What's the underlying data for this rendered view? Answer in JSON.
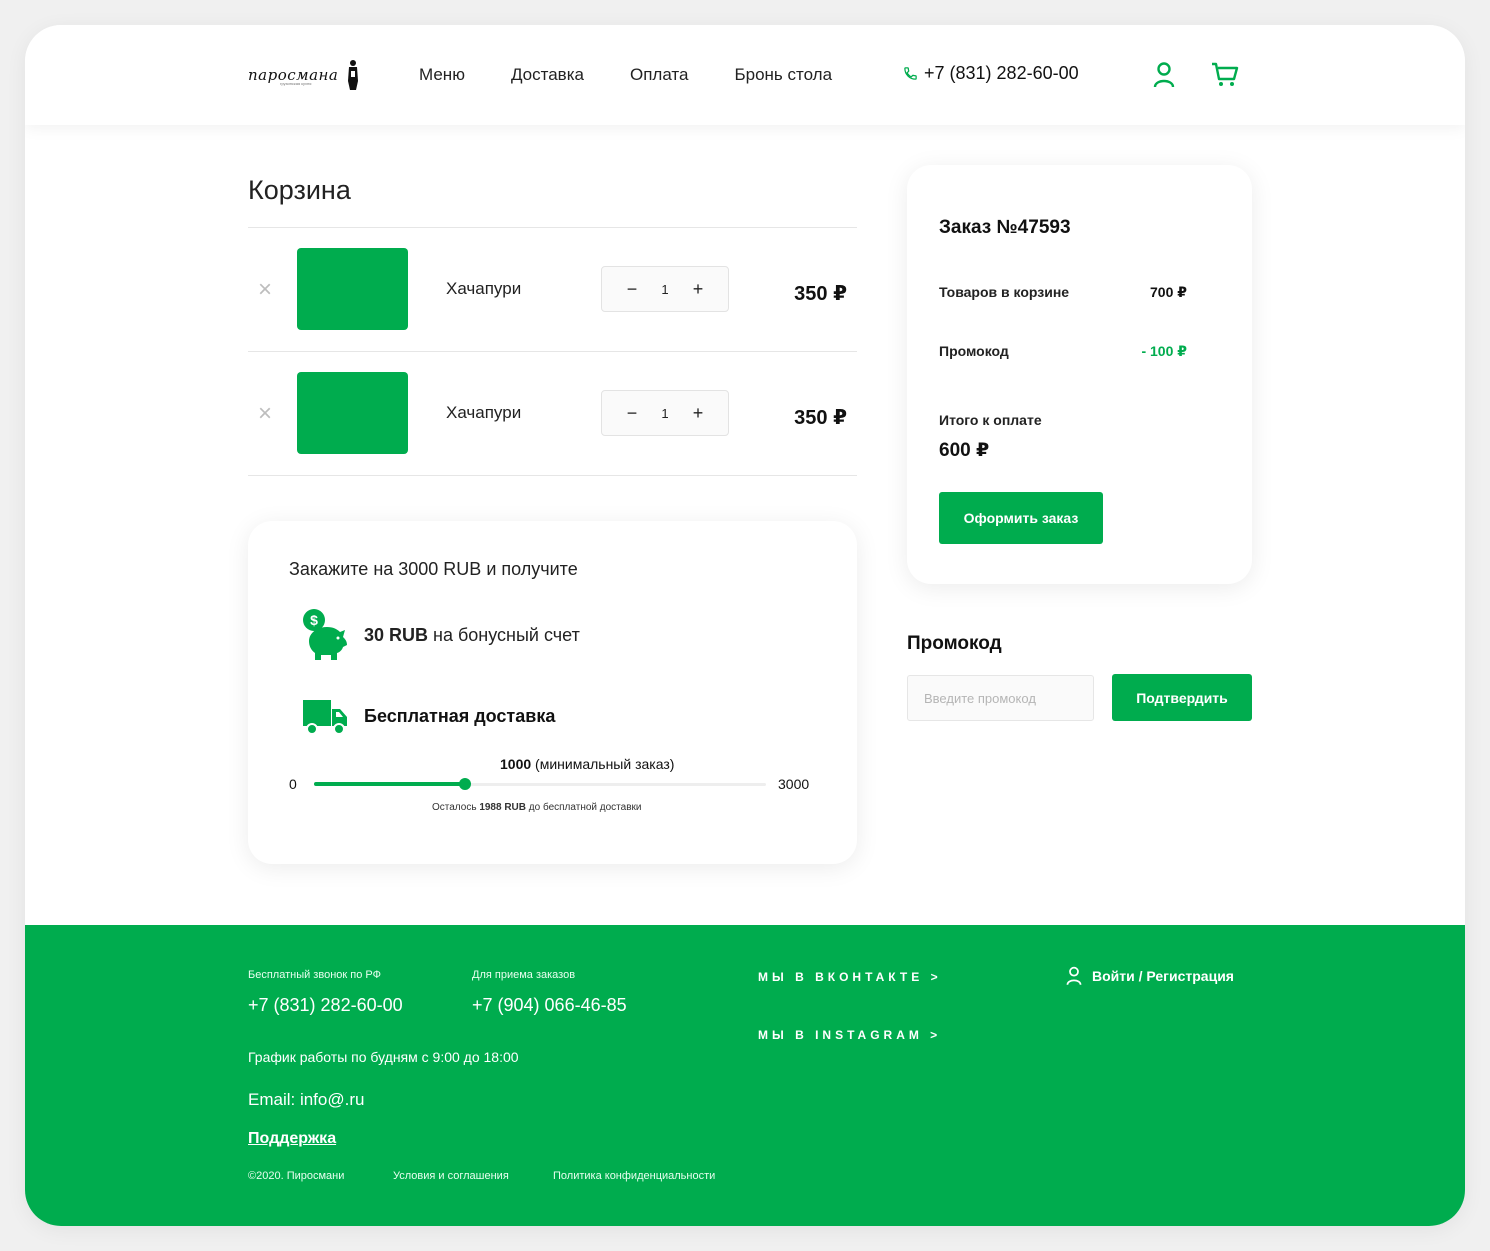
{
  "colors": {
    "accent": "#00ac4e",
    "text": "#1a1a1a",
    "muted": "#bdbdbd"
  },
  "header": {
    "logo_text": "паросмана",
    "logo_sub": "грузинская кухня",
    "nav": [
      "Меню",
      "Доставка",
      "Оплата",
      "Бронь стола"
    ],
    "phone": "+7 (831) 282-60-00",
    "icons": [
      "phone-icon",
      "user-icon",
      "cart-icon"
    ]
  },
  "cart": {
    "title": "Корзина",
    "items": [
      {
        "name": "Хачапури",
        "qty": "1",
        "price": "350 ₽",
        "minus": "−",
        "plus": "+",
        "remove": "×"
      },
      {
        "name": "Хачапури",
        "qty": "1",
        "price": "350 ₽",
        "minus": "−",
        "plus": "+",
        "remove": "×"
      }
    ]
  },
  "bonus": {
    "title": "Закажите на 3000 RUB и получите",
    "bonus_amount": "30 RUB",
    "bonus_rest": " на бонусный счет",
    "free_delivery": "Бесплатная доставка",
    "scale_min": "0",
    "scale_max": "3000",
    "min_order_value": "1000",
    "min_order_note": " (минимальный заказ)",
    "progress_fraction": 0.34,
    "min_order_fraction": 0.333,
    "remain_prefix": "Осталось ",
    "remain_amount": "1988 RUB",
    "remain_suffix": " до бесплатной доставки",
    "icons": [
      "piggy-bank-icon",
      "truck-icon"
    ]
  },
  "order": {
    "title": "Заказ №47593",
    "items_label": "Товаров в корзине",
    "items_value": "700 ₽",
    "promo_label": "Промокод",
    "promo_value": "- 100  ₽",
    "total_label": "Итого к оплате",
    "total_value": "600 ₽",
    "checkout_button": "Оформить заказ"
  },
  "promo": {
    "title": "Промокод",
    "placeholder": "Введите промокод",
    "confirm_button": "Подтвердить"
  },
  "footer": {
    "free_call_label": "Бесплатный звонок по РФ",
    "free_call_phone": "+7 (831) 282-60-00",
    "orders_label": "Для приема заказов",
    "orders_phone": "+7 (904) 066-46-85",
    "schedule": "График работы по будням с 9:00 до 18:00",
    "email": "Email: info@.ru",
    "support": "Поддержка",
    "vk": "МЫ В ВКОНТАКТЕ >",
    "instagram": "МЫ В INSTAGRAM >",
    "login": "Войти / Регистрация",
    "copyright": "©2020. Пиросмани",
    "terms": "Условия и соглашения",
    "privacy": "Политика конфиденциальности"
  }
}
